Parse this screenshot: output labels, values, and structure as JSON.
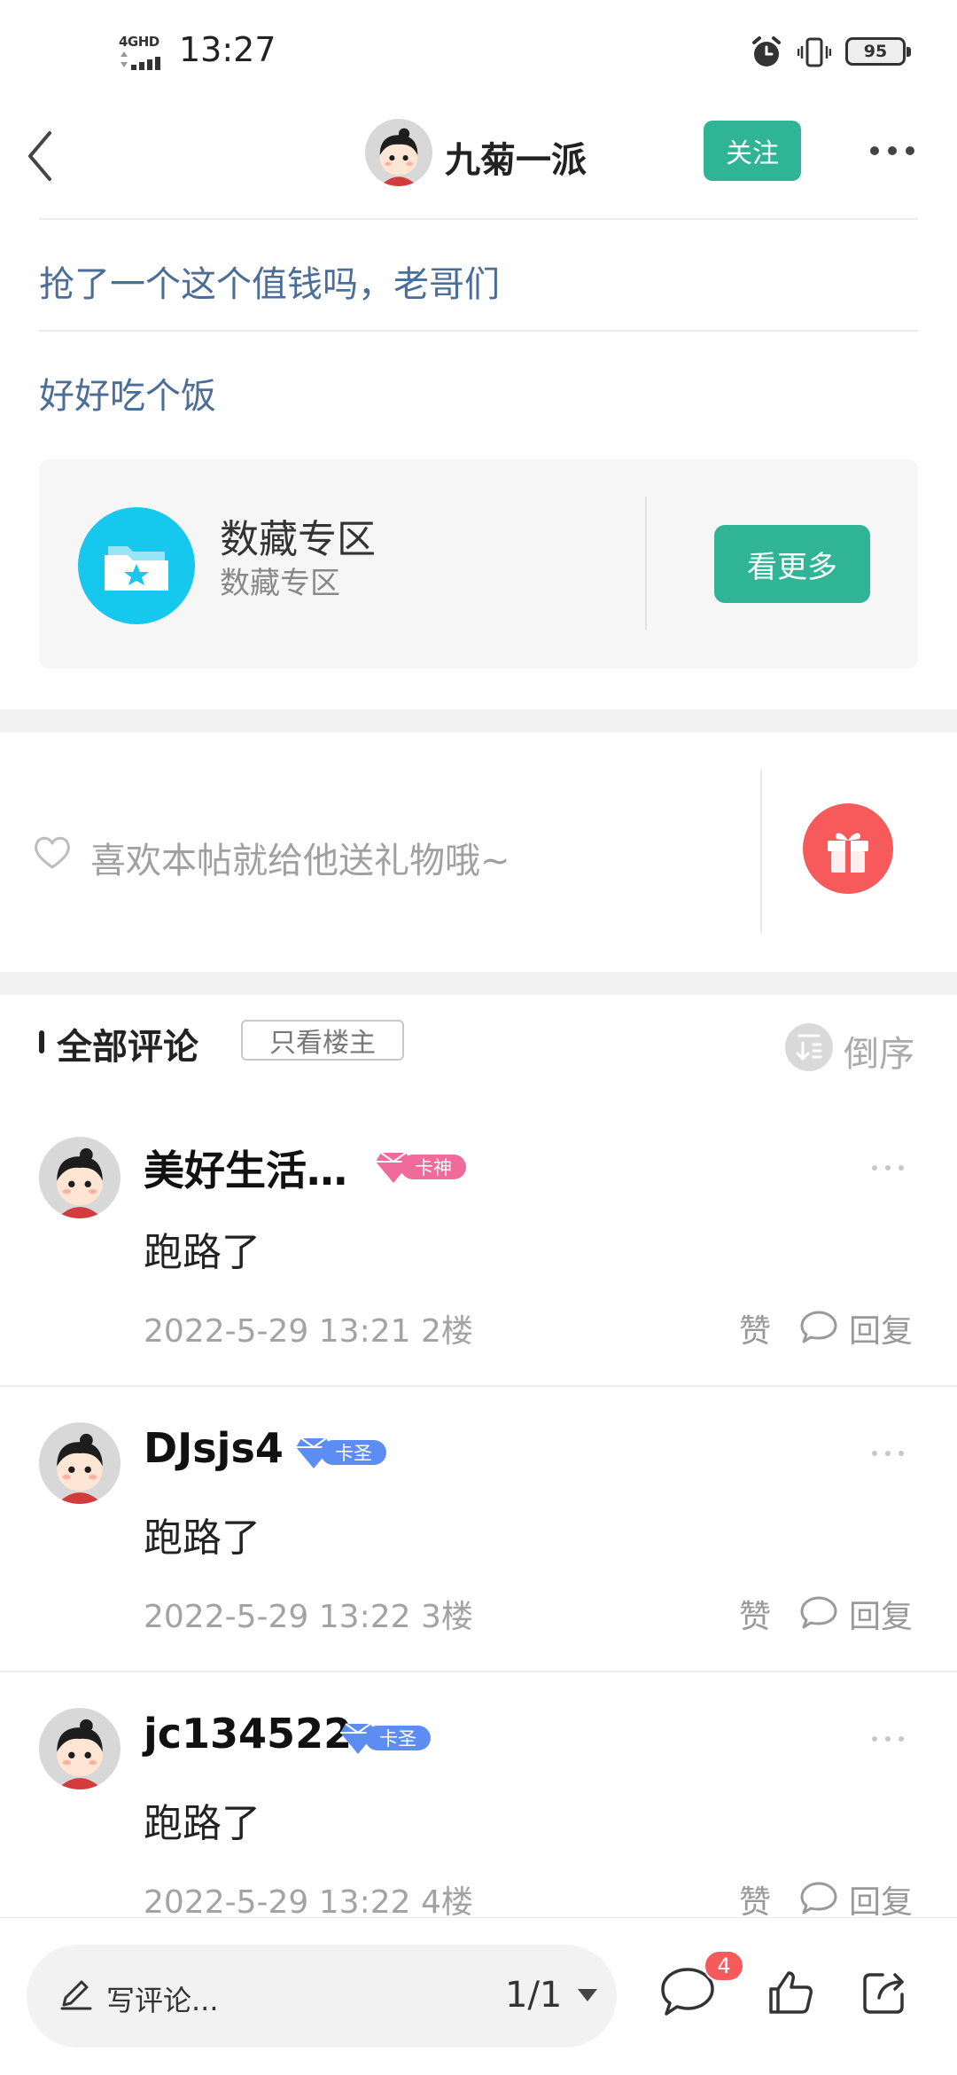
{
  "status_bar": {
    "network": "4GHD",
    "time": "13:27",
    "battery": "95"
  },
  "nav": {
    "author_name": "九菊一派",
    "follow_label": "关注"
  },
  "post": {
    "title": "抢了一个这个值钱吗，老哥们",
    "body": "好好吃个饭"
  },
  "topic": {
    "title": "数藏专区",
    "subtitle": "数藏专区",
    "button_label": "看更多",
    "icon_color": "#17c8ee"
  },
  "gift": {
    "prompt": "喜欢本帖就给他送礼物哦~",
    "button_color": "#f65a5a"
  },
  "comments_header": {
    "title": "全部评论",
    "only_op_label": "只看楼主",
    "sort_label": "倒序"
  },
  "comments": [
    {
      "username": "美好生活…",
      "badge": "卡神",
      "badge_color": "#f06a9a",
      "content": "跑路了",
      "meta": "2022-5-29 13:21  2楼",
      "like_label": "赞",
      "reply_label": "回复"
    },
    {
      "username": "DJsjs4",
      "badge": "卡圣",
      "badge_color": "#5d8df2",
      "content": "跑路了",
      "meta": "2022-5-29 13:22  3楼",
      "like_label": "赞",
      "reply_label": "回复"
    },
    {
      "username": "jc134522",
      "badge": "卡圣",
      "badge_color": "#5d8df2",
      "content": "跑路了",
      "meta": "2022-5-29 13:22  4楼",
      "like_label": "赞",
      "reply_label": "回复"
    }
  ],
  "bottom_bar": {
    "placeholder": "写评论...",
    "page_indicator": "1/1",
    "comment_count": "4"
  },
  "colors": {
    "accent": "#2fb596",
    "link_text": "#4b6d97",
    "red": "#f65a5a"
  }
}
